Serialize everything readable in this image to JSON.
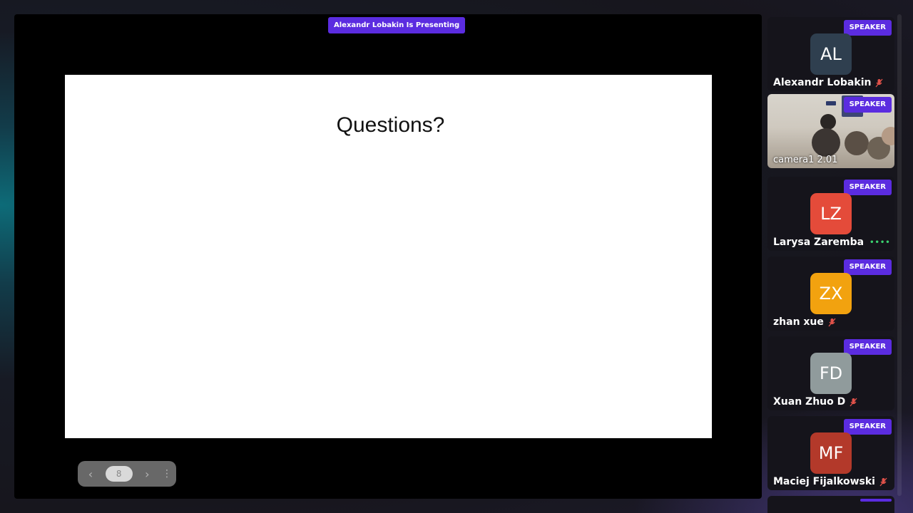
{
  "stage": {
    "presenting_label": "Alexandr Lobakin Is Presenting",
    "slide_title": "Questions?",
    "pager": {
      "prev_icon": "chevron-left-icon",
      "page": "8",
      "next_icon": "chevron-right-icon",
      "more_icon": "more-vertical-icon"
    }
  },
  "participants": [
    {
      "badge": "SPEAKER",
      "initials": "AL",
      "name": "Alexandr Lobakin",
      "color": "#2f3f4f",
      "status": "muted"
    },
    {
      "badge": "SPEAKER",
      "initials": "",
      "name": "camera1 2.01",
      "color": "",
      "status": "video"
    },
    {
      "badge": "SPEAKER",
      "initials": "LZ",
      "name": "Larysa Zaremba",
      "color": "#e44b3a",
      "status": "talking"
    },
    {
      "badge": "SPEAKER",
      "initials": "ZX",
      "name": "zhan xue",
      "color": "#f2a20f",
      "status": "muted"
    },
    {
      "badge": "SPEAKER",
      "initials": "FD",
      "name": "Xuan Zhuo D",
      "color": "#909b9c",
      "status": "muted"
    },
    {
      "badge": "SPEAKER",
      "initials": "MF",
      "name": "Maciej Fijalkowski",
      "color": "#b3392a",
      "status": "muted"
    }
  ],
  "colors": {
    "accent": "#5b2ce0",
    "muted_icon": "#e0524a",
    "talking": "#3bd16f"
  }
}
